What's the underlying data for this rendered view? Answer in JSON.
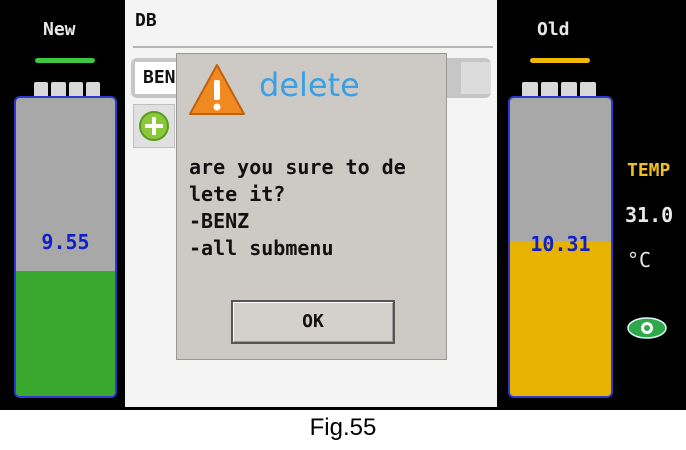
{
  "left_panel": {
    "title": "New",
    "value": "9.55",
    "fill_fraction": 0.42,
    "accent": "#3aa82e"
  },
  "right_panel": {
    "title": "Old",
    "value": "10.31",
    "fill_fraction": 0.52,
    "accent": "#e8b200"
  },
  "db_screen": {
    "title": "DB",
    "list_item": "BEN"
  },
  "dialog": {
    "title": "delete",
    "message": "are you sure to de\nlete it?\n-BENZ\n-all submenu",
    "ok_label": "OK",
    "title_color": "#3aa0e6"
  },
  "temperature": {
    "label": "TEMP",
    "value": "31.0",
    "unit": "°C"
  },
  "caption": "Fig.55"
}
